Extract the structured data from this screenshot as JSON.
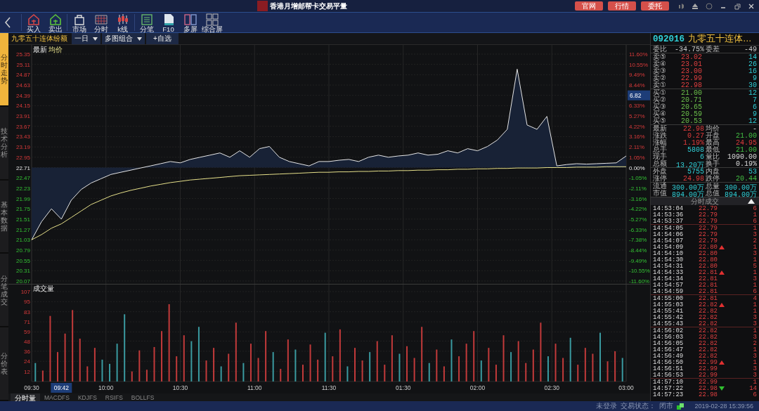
{
  "window": {
    "title": "香港月增邮帮卡交易平量"
  },
  "title_buttons": [
    "官网",
    "行情",
    "委托"
  ],
  "toolbar": [
    {
      "label": "买入",
      "kind": "buy"
    },
    {
      "label": "卖出",
      "kind": "sell"
    },
    {
      "label": "市场",
      "kind": "market"
    },
    {
      "label": "分时",
      "kind": "timeshare"
    },
    {
      "label": "k线",
      "kind": "kline"
    },
    {
      "label": "分笔",
      "kind": "ticks"
    },
    {
      "label": "F10",
      "kind": "doc"
    },
    {
      "label": "多屏",
      "kind": "multi"
    },
    {
      "label": "综合屏",
      "kind": "combo"
    }
  ],
  "side_tabs": [
    {
      "label": "分时走势",
      "selected": true
    },
    {
      "label": "技术分析",
      "selected": false
    },
    {
      "label": "基本数据",
      "selected": false
    },
    {
      "label": "分笔成交",
      "selected": false
    },
    {
      "label": "分价表",
      "selected": false
    }
  ],
  "chart_header": {
    "title": "九零五十连体纷额",
    "period": "一日",
    "layout": "多图组合",
    "add": "+自选"
  },
  "price_chart": {
    "percent_labels": [
      {
        "text": "11.60%",
        "kind": "tick"
      },
      {
        "text": "10.55%",
        "kind": "tick"
      },
      {
        "text": "9.49%",
        "kind": "tick"
      },
      {
        "text": "8.44%",
        "kind": "tick"
      },
      {
        "text": "6.82",
        "kind": "cursor"
      },
      {
        "text": "6.33%",
        "kind": "tick"
      },
      {
        "text": "5.27%",
        "kind": "tick"
      },
      {
        "text": "4.22%",
        "kind": "tick"
      },
      {
        "text": "3.16%",
        "kind": "tick"
      },
      {
        "text": "2.11%",
        "kind": "tick"
      },
      {
        "text": "1.05%",
        "kind": "tick"
      },
      {
        "text": "0.00%",
        "kind": "tick"
      },
      {
        "text": "-1.05%",
        "kind": "tick"
      },
      {
        "text": "-2.11%",
        "kind": "tick"
      },
      {
        "text": "-3.16%",
        "kind": "tick"
      },
      {
        "text": "-4.22%",
        "kind": "tick"
      },
      {
        "text": "-5.27%",
        "kind": "tick"
      },
      {
        "text": "-6.33%",
        "kind": "tick"
      },
      {
        "text": "-7.38%",
        "kind": "tick"
      },
      {
        "text": "-8.44%",
        "kind": "tick"
      },
      {
        "text": "-9.49%",
        "kind": "tick"
      },
      {
        "text": "-10.55%",
        "kind": "tick"
      },
      {
        "text": "-11.60%",
        "kind": "tick"
      }
    ],
    "chart_data": {
      "type": "line",
      "grid": true,
      "ylim": [
        20.07,
        25.35
      ],
      "yticks": [
        25.35,
        25.11,
        24.87,
        24.63,
        24.39,
        24.15,
        23.91,
        23.67,
        23.43,
        23.19,
        22.95,
        22.71,
        22.47,
        22.23,
        21.99,
        21.75,
        21.51,
        21.27,
        21.03,
        20.79,
        20.55,
        20.31,
        20.07
      ],
      "series": [
        {
          "name": "最新",
          "color": "#e6e6e6",
          "values": [
            21.03,
            21.45,
            21.75,
            21.51,
            21.95,
            22.2,
            22.35,
            22.45,
            22.55,
            22.6,
            22.65,
            22.7,
            22.75,
            22.8,
            22.85,
            22.82,
            22.9,
            22.95,
            23.0,
            23.05,
            22.95,
            23.1,
            22.95,
            23.15,
            23.2,
            22.95,
            22.85,
            22.8,
            22.75,
            22.85,
            22.85,
            22.88,
            22.9,
            22.85,
            22.95,
            23.0,
            22.95,
            22.98,
            23.0,
            23.05,
            23.0,
            23.02,
            23.1,
            23.05,
            23.15,
            23.1,
            23.2,
            23.35,
            23.6,
            25.0,
            23.7,
            23.6,
            23.9,
            22.75,
            22.78,
            22.8,
            22.79,
            22.8,
            22.81,
            22.82,
            22.98
          ]
        },
        {
          "name": "均价",
          "color": "#e6e08a",
          "values": [
            21.03,
            21.15,
            21.3,
            21.4,
            21.55,
            21.7,
            21.85,
            21.95,
            22.05,
            22.12,
            22.18,
            22.23,
            22.28,
            22.32,
            22.36,
            22.39,
            22.42,
            22.44,
            22.46,
            22.48,
            22.5,
            22.52,
            22.53,
            22.54,
            22.55,
            22.56,
            22.57,
            22.58,
            22.59,
            22.6,
            22.6,
            22.61,
            22.61,
            22.62,
            22.62,
            22.63,
            22.63,
            22.64,
            22.64,
            22.65,
            22.65,
            22.66,
            22.66,
            22.67,
            22.67,
            22.68,
            22.68,
            22.69,
            22.69,
            22.7,
            22.7,
            22.7,
            22.71,
            22.71,
            22.71,
            22.72,
            22.72,
            22.72,
            22.73,
            22.73,
            22.73
          ]
        }
      ]
    }
  },
  "volume_chart": {
    "chart_data": {
      "type": "bar",
      "title": "成交量",
      "grid": true,
      "ylim": [
        0,
        107
      ],
      "yticks": [
        107,
        95,
        83,
        71,
        59,
        48,
        36,
        24,
        12
      ],
      "series": [
        {
          "color": "#c23a3a",
          "values": [
            null,
            13,
            78,
            35,
            57,
            85,
            51,
            18,
            40,
            null,
            null,
            null,
            null,
            12,
            37,
            14,
            41,
            60,
            92,
            30,
            55,
            null,
            null,
            25,
            40,
            null,
            33,
            70,
            null,
            45,
            28,
            60,
            null,
            15,
            50,
            null,
            20,
            44,
            26,
            null,
            30,
            62,
            null,
            40,
            25,
            null,
            48,
            20,
            55,
            null,
            42,
            28,
            65,
            null,
            38,
            18,
            null,
            30,
            45,
            60,
            null,
            40,
            20,
            55,
            null,
            48,
            22,
            38,
            70,
            null,
            45,
            28,
            null,
            20,
            40,
            33,
            null,
            24,
            36,
            null
          ]
        },
        {
          "color": "#3a9aa0",
          "values": [
            22,
            null,
            null,
            null,
            null,
            null,
            null,
            null,
            null,
            26,
            21,
            45,
            80,
            null,
            null,
            null,
            null,
            null,
            null,
            null,
            null,
            48,
            65,
            null,
            null,
            18,
            null,
            null,
            22,
            null,
            null,
            null,
            35,
            null,
            null,
            38,
            null,
            null,
            null,
            58,
            null,
            null,
            18,
            null,
            null,
            35,
            null,
            null,
            null,
            33,
            null,
            null,
            null,
            22,
            null,
            null,
            50,
            null,
            null,
            null,
            25,
            null,
            null,
            null,
            35,
            null,
            null,
            null,
            null,
            30,
            null,
            null,
            52,
            null,
            null,
            null,
            58,
            null,
            null,
            28
          ]
        }
      ]
    }
  },
  "time_axis": {
    "labels": [
      "09:30",
      "10:00",
      "10:30",
      "11:00",
      "11:30",
      "01:30",
      "02:00",
      "02:30",
      "03:00"
    ],
    "cursor": "09:42"
  },
  "bottom_tabs": [
    {
      "label": "分时量",
      "selected": true
    },
    {
      "label": "MACDFS",
      "selected": false
    },
    {
      "label": "KDJFS",
      "selected": false
    },
    {
      "label": "RSIFS",
      "selected": false
    },
    {
      "label": "BOLLFS",
      "selected": false
    }
  ],
  "quote": {
    "code": "092016",
    "name": "九零五十连体…",
    "ratio": {
      "label": "委比",
      "value": "-34.75%",
      "diff_label": "委差",
      "diff": "-49"
    },
    "asks": [
      {
        "label": "卖⑤",
        "price": "23.02",
        "volume": "14"
      },
      {
        "label": "卖④",
        "price": "23.01",
        "volume": "26"
      },
      {
        "label": "卖③",
        "price": "23.00",
        "volume": "16"
      },
      {
        "label": "卖②",
        "price": "22.99",
        "volume": "9"
      },
      {
        "label": "卖①",
        "price": "22.98",
        "volume": "30"
      }
    ],
    "bids": [
      {
        "label": "买①",
        "price": "21.00",
        "volume": "12"
      },
      {
        "label": "买②",
        "price": "20.71",
        "volume": "7"
      },
      {
        "label": "买③",
        "price": "20.65",
        "volume": "6"
      },
      {
        "label": "买④",
        "price": "20.59",
        "volume": "9"
      },
      {
        "label": "买⑤",
        "price": "20.53",
        "volume": "12"
      }
    ],
    "stat_groups": [
      [
        [
          {
            "label": "最新",
            "value": "22.98",
            "kind": "rise"
          },
          {
            "label": "均价",
            "value": "-",
            "kind": "flat"
          }
        ],
        [
          {
            "label": "涨跌",
            "value": "0.27",
            "kind": "rise"
          },
          {
            "label": "开盘",
            "value": "21.00",
            "kind": "fall"
          }
        ],
        [
          {
            "label": "涨幅",
            "value": "1.19%",
            "kind": "rise"
          },
          {
            "label": "最高",
            "value": "24.95",
            "kind": "rise"
          }
        ],
        [
          {
            "label": "总手",
            "value": "5808",
            "kind": "amount"
          },
          {
            "label": "最低",
            "value": "21.00",
            "kind": "fall"
          }
        ],
        [
          {
            "label": "现手",
            "value": "6",
            "kind": "amount"
          },
          {
            "label": "量比",
            "value": "1090.00",
            "kind": "flat"
          }
        ],
        [
          {
            "label": "总额",
            "value": "13.20万",
            "kind": "amount"
          },
          {
            "label": "换手",
            "value": "0.19%",
            "kind": "flat"
          }
        ]
      ],
      [
        [
          {
            "label": "外盘",
            "value": "5755",
            "kind": "amount"
          },
          {
            "label": "内盘",
            "value": "53",
            "kind": "amount"
          }
        ],
        [
          {
            "label": "涨停",
            "value": "24.98",
            "kind": "rise"
          },
          {
            "label": "跌停",
            "value": "20.44",
            "kind": "fall"
          }
        ]
      ],
      [
        [
          {
            "label": "流通",
            "value": "300.00万",
            "kind": "amount"
          },
          {
            "label": "总量",
            "value": "300.00万",
            "kind": "amount"
          }
        ],
        [
          {
            "label": "市值",
            "value": "894.00万",
            "kind": "amount"
          },
          {
            "label": "总值",
            "value": "894.00万",
            "kind": "amount"
          }
        ]
      ]
    ]
  },
  "ticks": {
    "title": "分时成交",
    "minutes": [
      {
        "rows": [
          {
            "time": "14:53:04",
            "price": "22.79",
            "volume": "6",
            "kind": "flat"
          },
          {
            "time": "14:53:36",
            "price": "22.79",
            "volume": "1",
            "kind": "flat"
          },
          {
            "time": "14:53:37",
            "price": "22.79",
            "volume": "6",
            "kind": "flat"
          }
        ]
      },
      {
        "rows": [
          {
            "time": "14:54:05",
            "price": "22.79",
            "volume": "1",
            "kind": "flat"
          },
          {
            "time": "14:54:06",
            "price": "22.79",
            "volume": "3",
            "kind": "flat"
          },
          {
            "time": "14:54:07",
            "price": "22.79",
            "volume": "2",
            "kind": "flat"
          },
          {
            "time": "14:54:09",
            "price": "22.80",
            "volume": "1",
            "kind": "up"
          },
          {
            "time": "14:54:10",
            "price": "22.80",
            "volume": "3",
            "kind": "flat"
          },
          {
            "time": "14:54:30",
            "price": "22.80",
            "volume": "1",
            "kind": "flat"
          },
          {
            "time": "14:54:31",
            "price": "22.80",
            "volume": "5",
            "kind": "flat"
          },
          {
            "time": "14:54:33",
            "price": "22.81",
            "volume": "1",
            "kind": "up"
          },
          {
            "time": "14:54:34",
            "price": "22.81",
            "volume": "3",
            "kind": "flat"
          },
          {
            "time": "14:54:57",
            "price": "22.81",
            "volume": "1",
            "kind": "flat"
          },
          {
            "time": "14:54:59",
            "price": "22.81",
            "volume": "6",
            "kind": "flat"
          }
        ]
      },
      {
        "rows": [
          {
            "time": "14:55:00",
            "price": "22.81",
            "volume": "4",
            "kind": "flat"
          },
          {
            "time": "14:55:03",
            "price": "22.82",
            "volume": "1",
            "kind": "up"
          },
          {
            "time": "14:55:41",
            "price": "22.82",
            "volume": "1",
            "kind": "flat"
          },
          {
            "time": "14:55:42",
            "price": "22.82",
            "volume": "3",
            "kind": "flat"
          },
          {
            "time": "14:55:43",
            "price": "22.82",
            "volume": "3",
            "kind": "flat"
          }
        ]
      },
      {
        "rows": [
          {
            "time": "14:56:02",
            "price": "22.82",
            "volume": "1",
            "kind": "flat"
          },
          {
            "time": "14:56:03",
            "price": "22.82",
            "volume": "3",
            "kind": "flat"
          },
          {
            "time": "14:56:05",
            "price": "22.82",
            "volume": "2",
            "kind": "flat"
          },
          {
            "time": "14:56:47",
            "price": "22.82",
            "volume": "1",
            "kind": "flat"
          },
          {
            "time": "14:56:49",
            "price": "22.82",
            "volume": "3",
            "kind": "flat"
          },
          {
            "time": "14:56:50",
            "price": "22.99",
            "volume": "1",
            "kind": "up"
          },
          {
            "time": "14:56:51",
            "price": "22.99",
            "volume": "3",
            "kind": "flat"
          },
          {
            "time": "14:56:53",
            "price": "22.99",
            "volume": "3",
            "kind": "flat"
          }
        ]
      },
      {
        "rows": [
          {
            "time": "14:57:10",
            "price": "22.99",
            "volume": "1",
            "kind": "flat"
          },
          {
            "time": "14:57:22",
            "price": "22.98",
            "volume": "14",
            "kind": "down"
          },
          {
            "time": "14:57:23",
            "price": "22.98",
            "volume": "6",
            "kind": "flat"
          }
        ]
      }
    ]
  },
  "status_bar": {
    "login": "未登录",
    "trade_state_label": "交易状态：",
    "trade_state": "闭市",
    "datetime": "2019-02-28 15:39:56"
  }
}
